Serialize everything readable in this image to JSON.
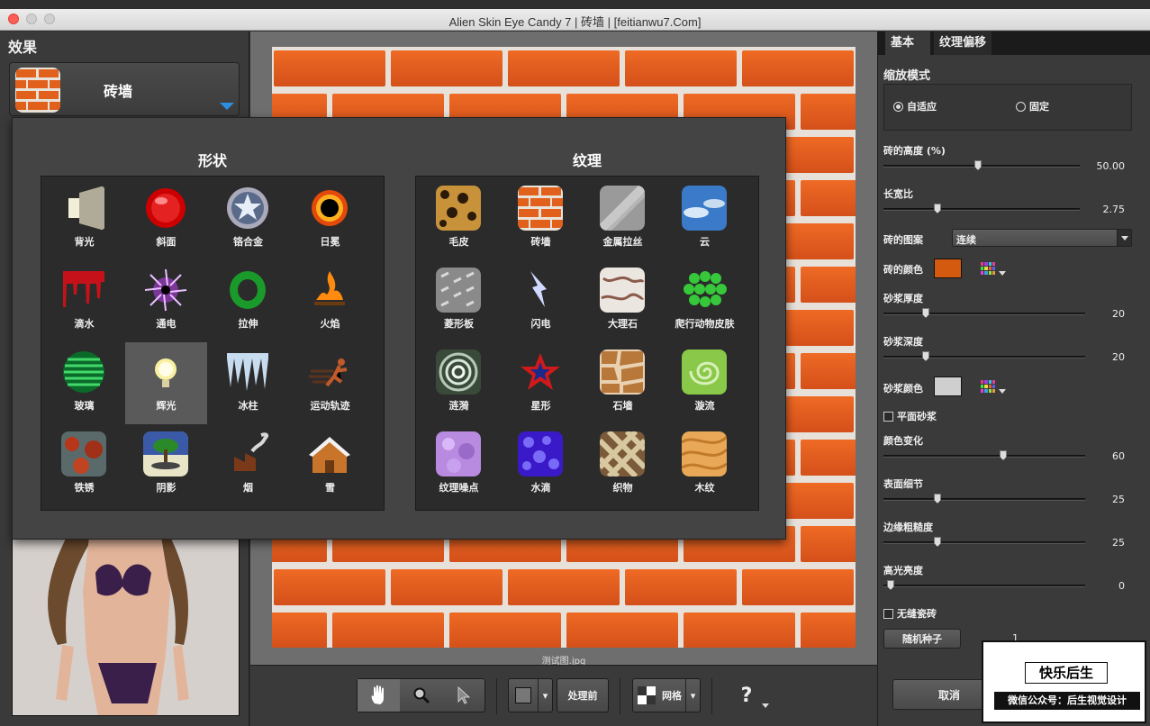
{
  "window": {
    "title": "Alien Skin Eye Candy 7 | 砖墙 | [feitianwu7.Com]"
  },
  "left": {
    "header": "效果",
    "effect_name": "砖墙"
  },
  "preview": {
    "file_name": "测试图.jpg"
  },
  "popup": {
    "shapes_title": "形状",
    "textures_title": "纹理",
    "shapes": [
      {
        "label": "背光",
        "icon": "backlight-icon"
      },
      {
        "label": "斜面",
        "icon": "bevel-icon"
      },
      {
        "label": "铬合金",
        "icon": "chrome-icon"
      },
      {
        "label": "日冕",
        "icon": "corona-icon"
      },
      {
        "label": "滴水",
        "icon": "drip-icon"
      },
      {
        "label": "通电",
        "icon": "electrify-icon"
      },
      {
        "label": "拉伸",
        "icon": "extrude-icon"
      },
      {
        "label": "火焰",
        "icon": "fire-icon"
      },
      {
        "label": "玻璃",
        "icon": "glass-icon"
      },
      {
        "label": "辉光",
        "icon": "glow-icon"
      },
      {
        "label": "冰柱",
        "icon": "icicle-icon"
      },
      {
        "label": "运动轨迹",
        "icon": "motion-trail-icon"
      },
      {
        "label": "铁锈",
        "icon": "rust-icon"
      },
      {
        "label": "阴影",
        "icon": "shadow-icon"
      },
      {
        "label": "烟",
        "icon": "smoke-icon"
      },
      {
        "label": "雪",
        "icon": "snow-icon"
      }
    ],
    "textures": [
      {
        "label": "毛皮",
        "icon": "fur-icon"
      },
      {
        "label": "砖墙",
        "icon": "brick-wall-icon"
      },
      {
        "label": "金属拉丝",
        "icon": "brushed-metal-icon"
      },
      {
        "label": "云",
        "icon": "clouds-icon"
      },
      {
        "label": "菱形板",
        "icon": "diamond-plate-icon"
      },
      {
        "label": "闪电",
        "icon": "lightning-icon"
      },
      {
        "label": "大理石",
        "icon": "marble-icon"
      },
      {
        "label": "爬行动物皮肤",
        "icon": "reptile-skin-icon"
      },
      {
        "label": "涟漪",
        "icon": "ripples-icon"
      },
      {
        "label": "星形",
        "icon": "star-icon"
      },
      {
        "label": "石墙",
        "icon": "stone-wall-icon"
      },
      {
        "label": "漩流",
        "icon": "swirl-icon"
      },
      {
        "label": "纹理噪点",
        "icon": "texture-noise-icon"
      },
      {
        "label": "水滴",
        "icon": "water-drops-icon"
      },
      {
        "label": "织物",
        "icon": "weave-icon"
      },
      {
        "label": "木纹",
        "icon": "wood-icon"
      }
    ]
  },
  "right": {
    "tab_basic": "基本",
    "tab_offset": "纹理偏移",
    "zoom_mode": "缩放模式",
    "zoom_fit": "自适应",
    "zoom_fixed": "固定",
    "brick_height_label": "砖的高度 (%)",
    "brick_height_value": "50.00",
    "brick_height": 0.5,
    "aspect_label": "长宽比",
    "aspect_value": "2.75",
    "pattern_label": "砖的图案",
    "pattern_value": "连续",
    "brick_color_label": "砖的颜色",
    "brick_color": "#d45a10",
    "mortar_thick_label": "砂浆厚度",
    "mortar_thick_value": "20",
    "mortar_depth_label": "砂浆深度",
    "mortar_depth_value": "20",
    "mortar_color_label": "砂浆颜色",
    "mortar_color": "#cfcfcf",
    "flat_mortar_label": "平面砂浆",
    "color_var_label": "颜色变化",
    "color_var_value": "60",
    "surface_detail_label": "表面细节",
    "surface_detail_value": "25",
    "edge_rough_label": "边缘粗糙度",
    "edge_rough_value": "25",
    "highlight_label": "高光亮度",
    "highlight_value": "0",
    "seamless_label": "无缝瓷砖",
    "random_seed_label": "随机种子",
    "random_seed_value": "1",
    "cancel_label": "取消"
  },
  "toolbar": {
    "before_label": "处理前",
    "grid_label": "网格",
    "help_label": "?"
  },
  "watermark": {
    "title": "快乐后生",
    "subtitle": "微信公众号：后生视觉设计"
  }
}
